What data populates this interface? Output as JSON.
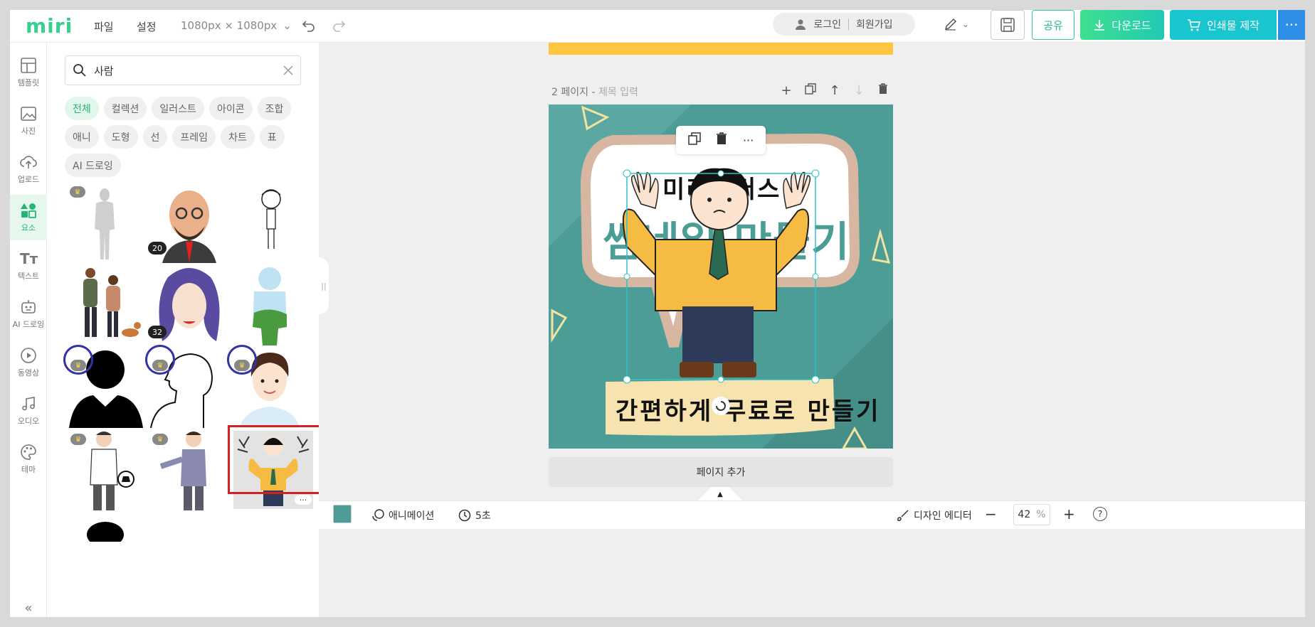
{
  "topbar": {
    "logo": "miri",
    "file_menu": "파일",
    "settings_menu": "설정",
    "canvas_size": "1080px × 1080px",
    "login": "로그인",
    "signup": "회원가입",
    "share": "공유",
    "download": "다운로드",
    "print": "인쇄물 제작"
  },
  "rail": {
    "items": [
      {
        "label": "템플릿",
        "icon": "template-icon"
      },
      {
        "label": "사진",
        "icon": "photo-icon"
      },
      {
        "label": "업로드",
        "icon": "upload-icon"
      },
      {
        "label": "요소",
        "icon": "elements-icon"
      },
      {
        "label": "텍스트",
        "icon": "text-icon"
      },
      {
        "label": "AI 드로잉",
        "icon": "ai-drawing-icon"
      },
      {
        "label": "동영상",
        "icon": "video-icon"
      },
      {
        "label": "오디오",
        "icon": "audio-icon"
      },
      {
        "label": "테마",
        "icon": "theme-icon"
      }
    ],
    "active": "요소"
  },
  "panel": {
    "search": {
      "value": "사람",
      "placeholder": ""
    },
    "chips": [
      "전체",
      "컬렉션",
      "일러스트",
      "아이콘",
      "조합",
      "애니",
      "도형",
      "선",
      "프레임",
      "차트",
      "표",
      "AI 드로잉"
    ],
    "active_chip": "전체",
    "badges": {
      "beard_man": "20",
      "woman_face": "32"
    }
  },
  "canvas": {
    "page_label": "2 페이지 -",
    "page_title_placeholder": "제목 입력",
    "art_heading_partial": "미리캔버스",
    "art_title": "썸네일 만들기",
    "art_subtitle": "간편하게 무료로 만들기",
    "add_page": "페이지 추가"
  },
  "bottombar": {
    "animation": "애니메이션",
    "duration": "5초",
    "design_editor": "디자인 에디터",
    "zoom": "42",
    "zoom_unit": "%"
  },
  "colors": {
    "brand_green": "#35d18f",
    "canvas_teal": "#4d9d97",
    "yellow": "#ffc640"
  }
}
